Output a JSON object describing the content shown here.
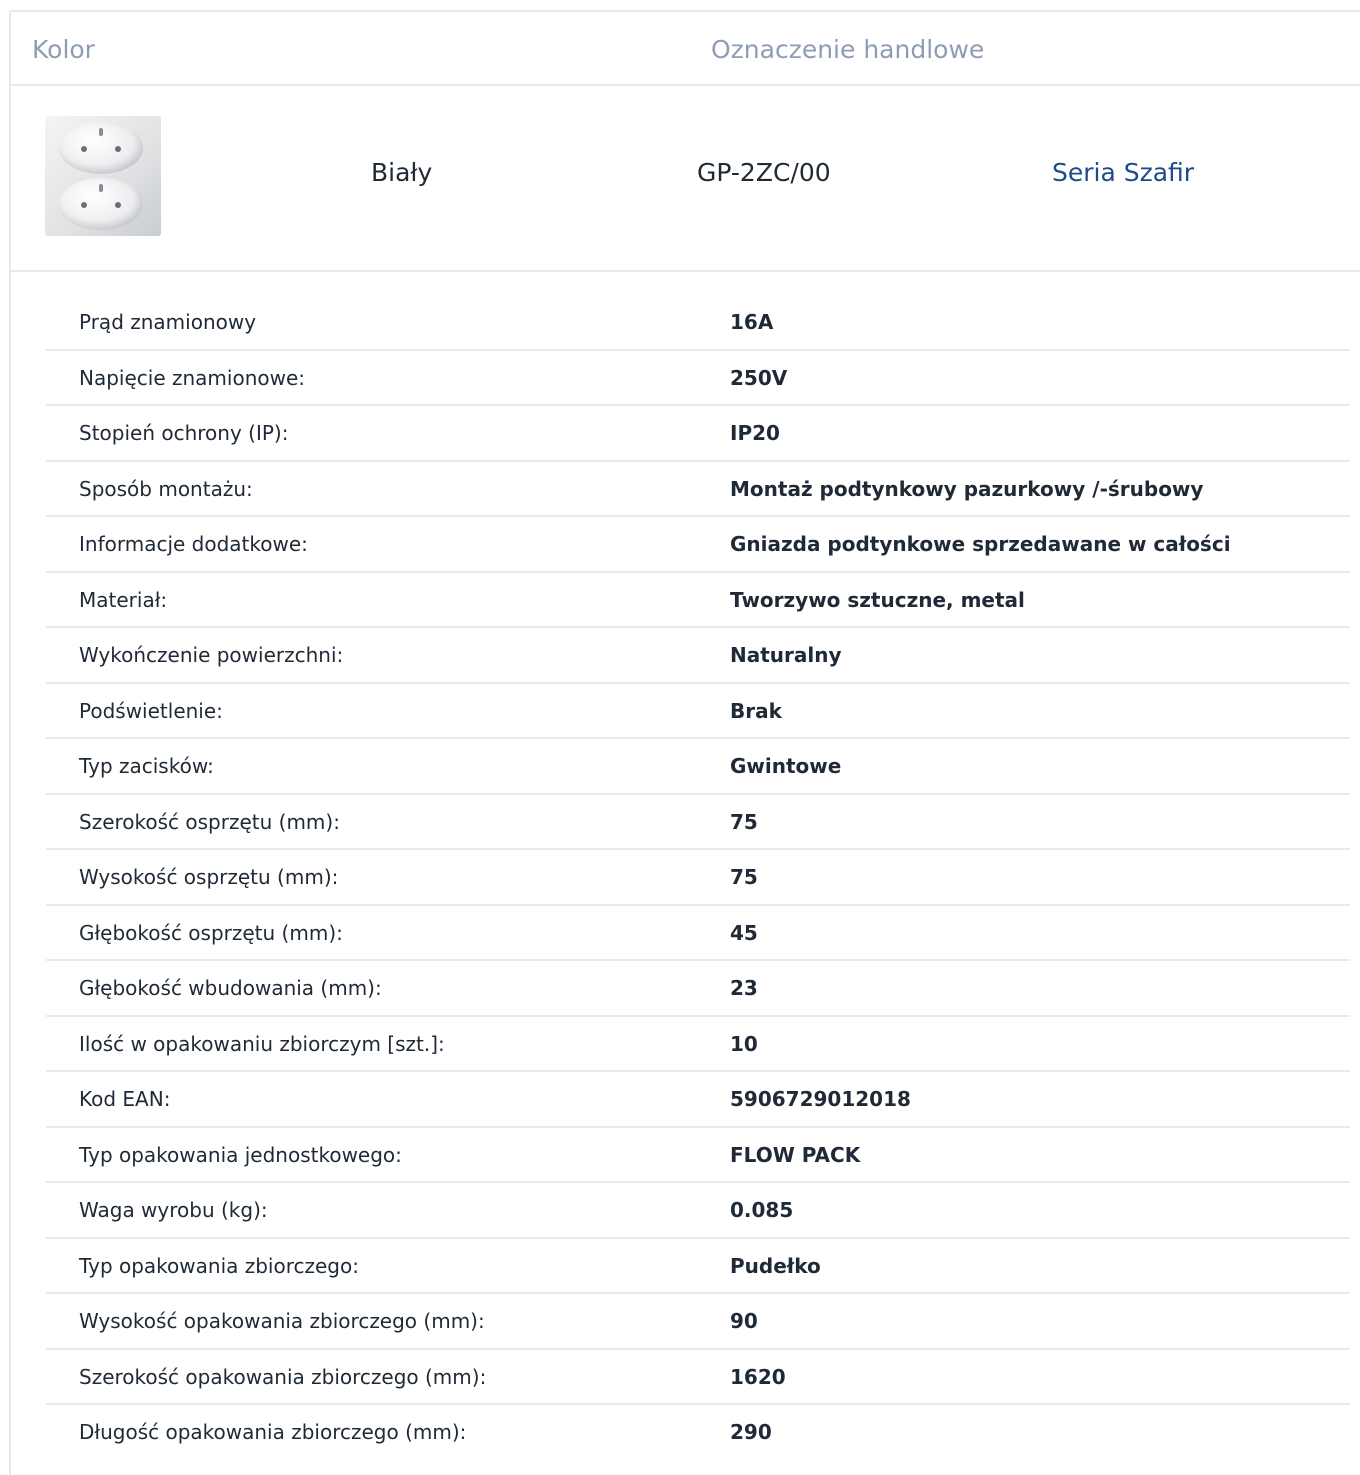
{
  "table_header": {
    "kolor": "Kolor",
    "oznaczenie": "Oznaczenie handlowe"
  },
  "product": {
    "image_icon": "double-socket-icon",
    "color_name": "Biały",
    "trade_code": "GP-2ZC/00",
    "series_link": "Seria Szafir",
    "link_color": "#1e4a8a"
  },
  "specs": [
    {
      "label": "Prąd znamionowy",
      "value": "16A"
    },
    {
      "label": "Napięcie znamionowe:",
      "value": "250V"
    },
    {
      "label": "Stopień ochrony (IP):",
      "value": "IP20"
    },
    {
      "label": "Sposób montażu:",
      "value": "Montaż podtynkowy pazurkowy /-śrubowy"
    },
    {
      "label": "Informacje dodatkowe:",
      "value": "Gniazda podtynkowe sprzedawane w całości"
    },
    {
      "label": "Materiał:",
      "value": "Tworzywo sztuczne, metal"
    },
    {
      "label": "Wykończenie powierzchni:",
      "value": "Naturalny"
    },
    {
      "label": "Podświetlenie:",
      "value": "Brak"
    },
    {
      "label": "Typ zacisków:",
      "value": "Gwintowe"
    },
    {
      "label": "Szerokość osprzętu (mm):",
      "value": "75"
    },
    {
      "label": "Wysokość osprzętu (mm):",
      "value": "75"
    },
    {
      "label": "Głębokość osprzętu (mm):",
      "value": "45"
    },
    {
      "label": "Głębokość wbudowania (mm):",
      "value": "23"
    },
    {
      "label": "Ilość w opakowaniu zbiorczym [szt.]:",
      "value": "10"
    },
    {
      "label": "Kod EAN:",
      "value": "5906729012018"
    },
    {
      "label": "Typ opakowania jednostkowego:",
      "value": "FLOW PACK"
    },
    {
      "label": "Waga wyrobu (kg):",
      "value": "0.085"
    },
    {
      "label": "Typ opakowania zbiorczego:",
      "value": "Pudełko"
    },
    {
      "label": "Wysokość opakowania zbiorczego (mm):",
      "value": "90"
    },
    {
      "label": "Szerokość opakowania zbiorczego (mm):",
      "value": "1620"
    },
    {
      "label": "Długość opakowania zbiorczego (mm):",
      "value": "290"
    }
  ]
}
